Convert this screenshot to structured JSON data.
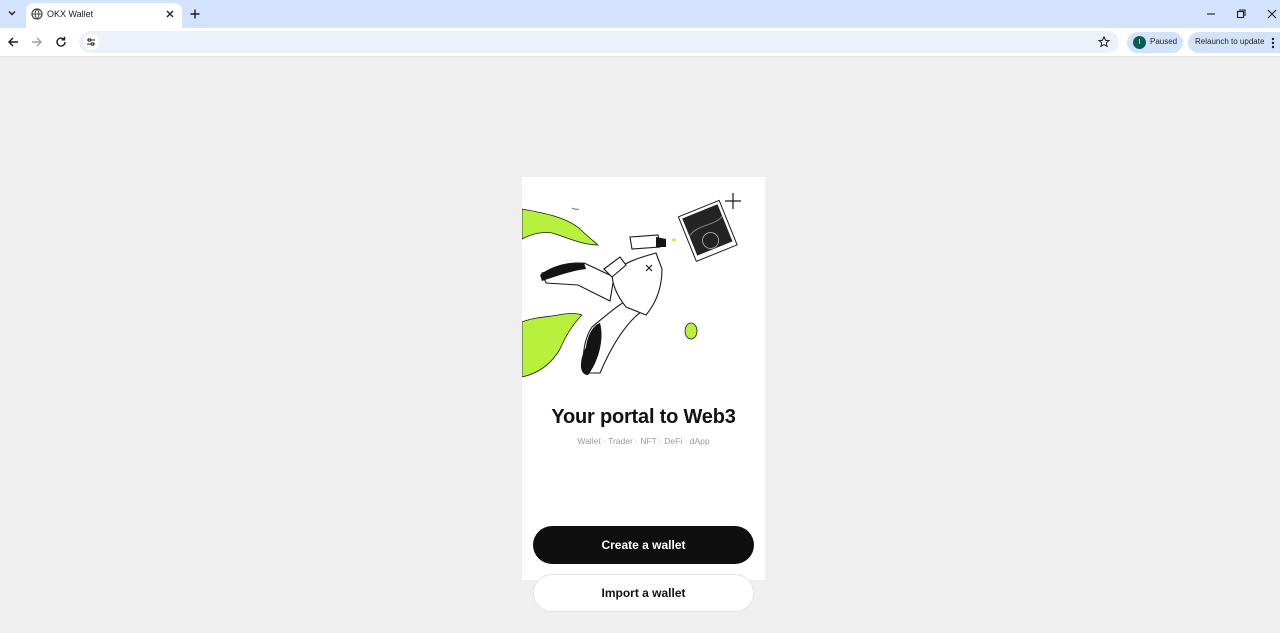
{
  "browser": {
    "tab": {
      "title": "OKX Wallet"
    },
    "toolbar": {
      "profile_status": "Paused",
      "profile_initial": "I",
      "relaunch_label": "Relaunch to update"
    }
  },
  "popup": {
    "headline": "Your portal to Web3",
    "subline": "Wallet · Trader · NFT · DeFi · dApp",
    "create_button": "Create a wallet",
    "import_button": "Import a wallet"
  },
  "colors": {
    "accent_lime": "#b7f13e",
    "primary_button": "#0f0f0f",
    "tabstrip": "#d3e3fd"
  },
  "icons": [
    "tab-search-icon",
    "globe-icon",
    "close-icon",
    "plus-icon",
    "minimize-icon",
    "restore-icon",
    "back-arrow-icon",
    "forward-arrow-icon",
    "reload-icon",
    "site-settings-icon",
    "star-icon",
    "kebab-menu-icon"
  ]
}
